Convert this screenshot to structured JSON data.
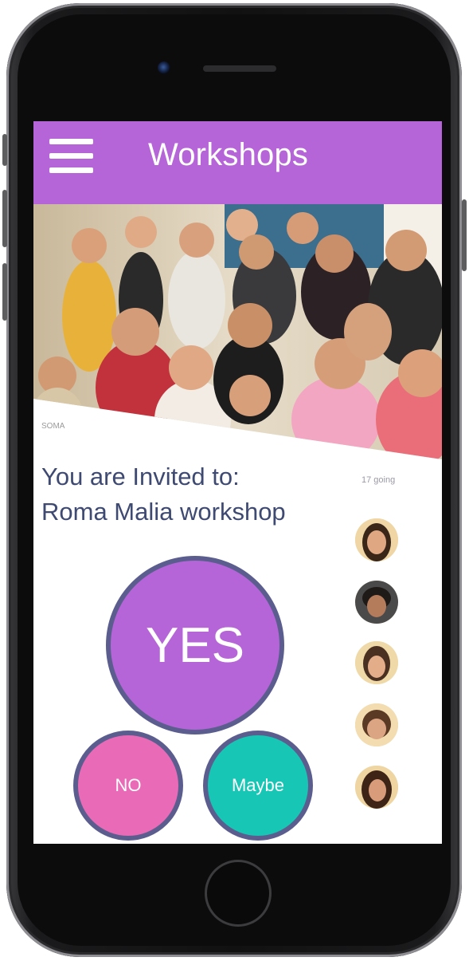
{
  "header": {
    "title": "Workshops",
    "menu_icon": "hamburger-menu-icon"
  },
  "hero": {
    "photo_label": "SOMA"
  },
  "invite": {
    "line1": "You are Invited to:",
    "line2": "Roma Malia workshop"
  },
  "attendees": {
    "count_label": "17 going",
    "avatar_count": 5
  },
  "rsvp": {
    "yes": "YES",
    "no": "NO",
    "maybe": "Maybe"
  },
  "colors": {
    "accent": "#b565d8",
    "yes": "#b565d8",
    "no": "#e96bb7",
    "maybe": "#17c6b4",
    "ring": "#5b5d8e",
    "text": "#3f4a72"
  }
}
